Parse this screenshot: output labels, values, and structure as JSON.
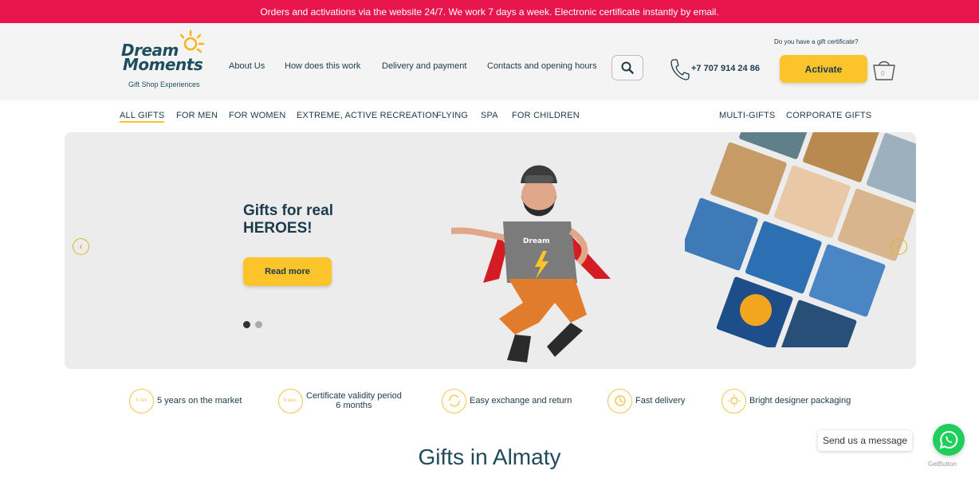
{
  "announcement": "Orders and activations via the website 24/7. We work 7 days a week. Electronic certificate instantly by email.",
  "logo": {
    "line1": "Dream",
    "line2": "Moments",
    "tagline": "Gift Shop Experiences"
  },
  "nav": [
    "About Us",
    "How does this work",
    "Delivery and payment",
    "Contacts and opening hours"
  ],
  "phone": "+7 707 914 24 86",
  "gift_question": "Do you have a gift certificate?",
  "activate_label": "Activate",
  "cart_count": "0",
  "categories": [
    "ALL GIFTS",
    "FOR MEN",
    "FOR WOMEN",
    "EXTREME, ACTIVE RECREATION",
    "FLYING",
    "SPA",
    "FOR CHILDREN",
    "MULTI-GIFTS",
    "CORPORATE GIFTS"
  ],
  "active_category": "ALL GIFTS",
  "hero": {
    "title_line1": "Gifts for real",
    "title_line2": "HEROES!",
    "button": "Read more",
    "slide_active": 1,
    "slide_total": 2
  },
  "features": [
    {
      "icon": "5 лет",
      "label": "5 years on the market"
    },
    {
      "icon": "6 мес.",
      "label_line1": "Certificate validity period",
      "label_line2": "6 months"
    },
    {
      "icon": "exchange-icon",
      "label": "Easy exchange and return"
    },
    {
      "icon": "clock-icon",
      "label": "Fast delivery"
    },
    {
      "icon": "sun-icon",
      "label": "Bright designer packaging"
    }
  ],
  "section_title": "Gifts in Almaty",
  "chat": {
    "bubble": "Send us a message",
    "brand": "GetButton"
  },
  "colors": {
    "accent_red": "#e8154d",
    "accent_yellow": "#fcc42b",
    "text_dark": "#1b3a4b",
    "whatsapp_green": "#1fcf5c"
  }
}
